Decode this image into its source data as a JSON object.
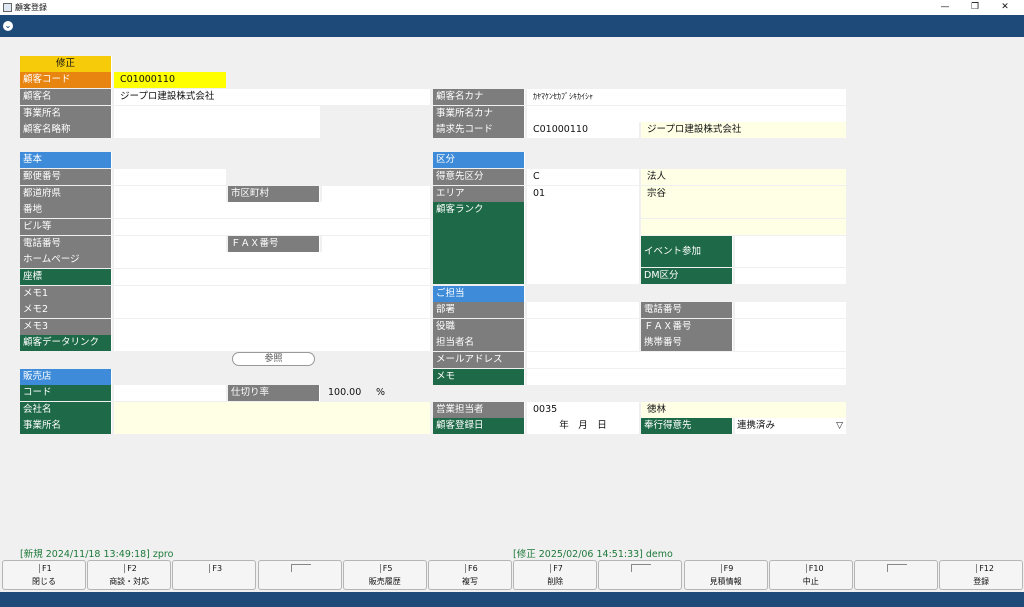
{
  "window": {
    "title": "顧客登録",
    "minimize": "—",
    "restore": "❐",
    "close": "✕"
  },
  "mode_label": "修正",
  "left": {
    "customer_code": {
      "label": "顧客コード",
      "value": "C01000110"
    },
    "customer_name": {
      "label": "顧客名",
      "value": "ジープロ建設株式会社"
    },
    "office_name": {
      "label": "事業所名",
      "value": ""
    },
    "short_name": {
      "label": "顧客名略称",
      "value": ""
    },
    "basic_header": "基本",
    "postal": {
      "label": "郵便番号",
      "value": ""
    },
    "prefecture": {
      "label": "都道府県",
      "value": ""
    },
    "city": {
      "label": "市区町村",
      "value": ""
    },
    "address": {
      "label": "番地",
      "value": ""
    },
    "building": {
      "label": "ビル等",
      "value": ""
    },
    "phone": {
      "label": "電話番号",
      "value": ""
    },
    "fax": {
      "label": "ＦＡＸ番号",
      "value": ""
    },
    "homepage": {
      "label": "ホームページ",
      "value": ""
    },
    "coordinates": {
      "label": "座標",
      "value": ""
    },
    "memo1": {
      "label": "メモ1",
      "value": ""
    },
    "memo2": {
      "label": "メモ2",
      "value": ""
    },
    "memo3": {
      "label": "メモ3",
      "value": ""
    },
    "data_link": {
      "label": "顧客データリンク",
      "value": ""
    },
    "ref_button": "参照",
    "dealer_header": "販売店",
    "dealer_code": {
      "label": "コード",
      "value": ""
    },
    "wholesale_rate": {
      "label": "仕切り率",
      "value": "100.00",
      "unit": "%"
    },
    "company": {
      "label": "会社名",
      "value": ""
    },
    "dealer_office": {
      "label": "事業所名",
      "value": ""
    }
  },
  "right": {
    "kana": {
      "label": "顧客名カナ",
      "value": "ｶﾔﾏｹﾝｾｶﾌﾞｼｷｶｲｼｬ"
    },
    "office_kana": {
      "label": "事業所名カナ",
      "value": ""
    },
    "billing": {
      "label": "請求先コード",
      "value": "C01000110",
      "name": "ジープロ建設株式会社"
    },
    "category_header": "区分",
    "client_class": {
      "label": "得意先区分",
      "value": "C",
      "name": "法人"
    },
    "area": {
      "label": "エリア",
      "value": "01",
      "name": "宗谷"
    },
    "rank": {
      "label": "顧客ランク",
      "value": ""
    },
    "event": {
      "label": "イベント参加",
      "value": ""
    },
    "dm": {
      "label": "DM区分",
      "value": ""
    },
    "contact_header": "ご担当",
    "dept": {
      "label": "部署",
      "value": ""
    },
    "tel": {
      "label": "電話番号",
      "value": ""
    },
    "position": {
      "label": "役職",
      "value": ""
    },
    "fax": {
      "label": "ＦＡＸ番号",
      "value": ""
    },
    "person": {
      "label": "担当者名",
      "value": ""
    },
    "mobile": {
      "label": "携帯番号",
      "value": ""
    },
    "email": {
      "label": "メールアドレス",
      "value": ""
    },
    "memo": {
      "label": "メモ",
      "value": ""
    },
    "sales_rep": {
      "label": "営業担当者",
      "value": "0035",
      "name": "徳林"
    },
    "reg_date": {
      "label": "顧客登録日",
      "value": "年　月　日"
    },
    "magistrate": {
      "label": "奉行得意先",
      "value": "連携済み",
      "arrow": "▽"
    }
  },
  "status": {
    "new": "[新規 2024/11/18 13:49:18] zpro",
    "modified": "[修正 2025/02/06 14:51:33] demo"
  },
  "fkeys": [
    {
      "key": "F1",
      "label": "閉じる"
    },
    {
      "key": "F2",
      "label": "商談・対応"
    },
    {
      "key": "F3",
      "label": ""
    },
    {
      "key": "",
      "label": ""
    },
    {
      "key": "F5",
      "label": "販売履歴"
    },
    {
      "key": "F6",
      "label": "複写"
    },
    {
      "key": "F7",
      "label": "削除"
    },
    {
      "key": "",
      "label": ""
    },
    {
      "key": "F9",
      "label": "見積情報"
    },
    {
      "key": "F10",
      "label": "中止"
    },
    {
      "key": "",
      "label": ""
    },
    {
      "key": "F12",
      "label": "登録"
    }
  ],
  "colors": {
    "header_bar": "#1d4a78",
    "label_gray": "#7d7d7d",
    "label_green": "#1e6a48",
    "label_blue": "#3d8bd9",
    "label_orange": "#e88410",
    "mode_yellow": "#f6cc0a",
    "highlight_yellow": "#ffff00",
    "cream": "#ffffe6"
  }
}
